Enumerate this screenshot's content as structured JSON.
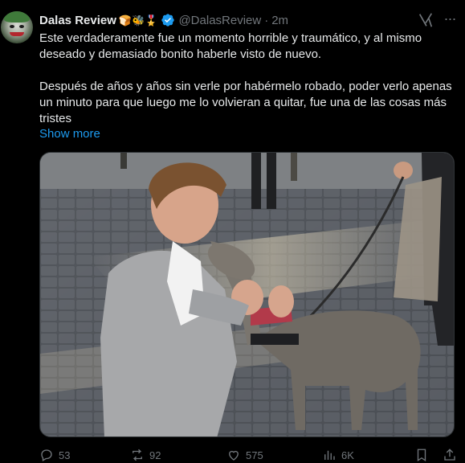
{
  "author": {
    "display_name": "Dalas Review",
    "badges": "🍞🐝🎖️",
    "handle": "@DalasReview",
    "separator": "·",
    "time": "2m",
    "verified": true
  },
  "tweet": {
    "text": "Este verdaderamente fue un momento horrible y traumático, y al mismo deseado y demasiado bonito haberle visto de nuevo.\n\nDespués de años y años sin verle por habérmelo robado, poder verlo apenas un minuto para que luego me lo volvieran a quitar, fue una de las cosas más tristes",
    "show_more": "Show more"
  },
  "actions": {
    "replies": "53",
    "reposts": "92",
    "likes": "575",
    "views": "6K"
  },
  "icons": {
    "verified": "verified-badge-icon",
    "grok": "grok-icon",
    "more": "more-options-icon",
    "reply": "reply-icon",
    "repost": "repost-icon",
    "like": "like-icon",
    "views": "views-icon",
    "bookmark": "bookmark-icon",
    "share": "share-icon"
  },
  "colors": {
    "background": "#000000",
    "text": "#e7e9ea",
    "muted": "#71767b",
    "link": "#1d9bf0",
    "verified": "#1d9bf0"
  }
}
